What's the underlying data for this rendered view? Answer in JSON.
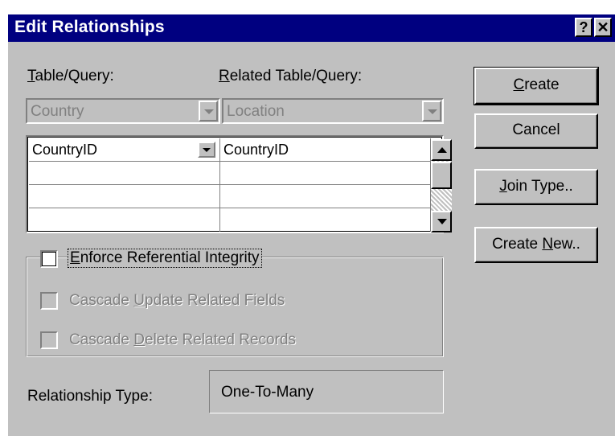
{
  "dialog": {
    "title": "Edit Relationships",
    "help_button": "?",
    "close_button": "✕"
  },
  "labels": {
    "table_query_accel": "T",
    "table_query_rest": "able/Query:",
    "related_query_accel": "R",
    "related_query_rest": "elated Table/Query:"
  },
  "combos": {
    "table_value": "Country",
    "related_value": "Location"
  },
  "field_grid": {
    "rows": [
      [
        "CountryID",
        "CountryID"
      ],
      [
        "",
        ""
      ],
      [
        "",
        ""
      ],
      [
        "",
        ""
      ]
    ]
  },
  "options": {
    "enforce_accel": "E",
    "enforce_rest": "nforce Referential Integrity",
    "enforce_checked": false,
    "cascade_update_pre": "Cascade ",
    "cascade_update_accel": "U",
    "cascade_update_rest": "pdate Related Fields",
    "cascade_delete_pre": "Cascade ",
    "cascade_delete_accel": "D",
    "cascade_delete_rest": "elete Related Records"
  },
  "relationship": {
    "label": "Relationship Type:",
    "value": "One-To-Many"
  },
  "buttons": {
    "create_accel": "C",
    "create_rest": "reate",
    "cancel": "Cancel",
    "join_accel": "J",
    "join_rest": "oin Type..",
    "create_new_pre": "Create ",
    "create_new_accel": "N",
    "create_new_rest": "ew.."
  },
  "colors": {
    "title_bar": "#000080",
    "face": "#c0c0c0",
    "disabled_text": "#808080"
  }
}
